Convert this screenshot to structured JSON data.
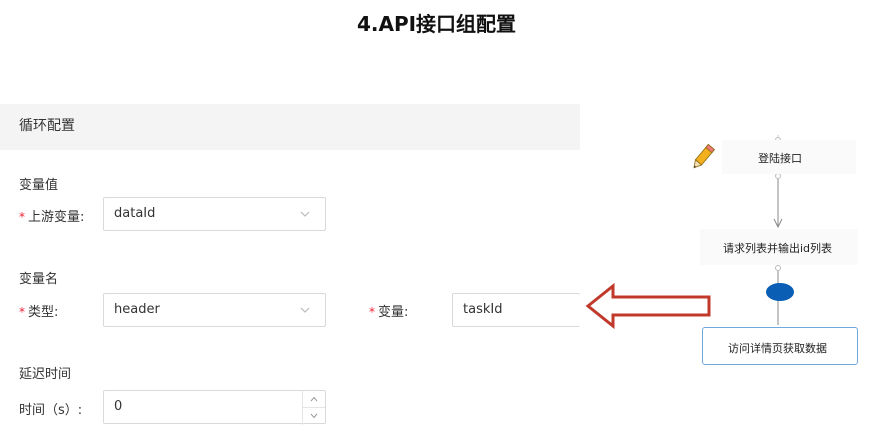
{
  "title": "4.API接口组配置",
  "config": {
    "header": "循环配置",
    "variable_value_section": "变量值",
    "upstream_label": "上游变量:",
    "upstream_value": "dataId",
    "variable_name_section": "变量名",
    "type_label": "类型:",
    "type_value": "header",
    "variable_label": "变量:",
    "variable_value": "taskId",
    "delay_section": "延迟时间",
    "time_label": "时间（s）:",
    "time_value": "0",
    "required_mark": "*"
  },
  "flow": {
    "nodes": [
      "登陆接口",
      "请求列表并输出id列表",
      "访问详情页获取数据"
    ]
  },
  "colors": {
    "required": "#e23333",
    "arrow": "#c0392b",
    "flow_dot": "#0a5fb4",
    "selected_node_border": "#6fa8dc"
  },
  "icons": [
    "pencil-icon",
    "chevron-down-icon",
    "chevron-up-icon",
    "left-arrow-icon"
  ]
}
